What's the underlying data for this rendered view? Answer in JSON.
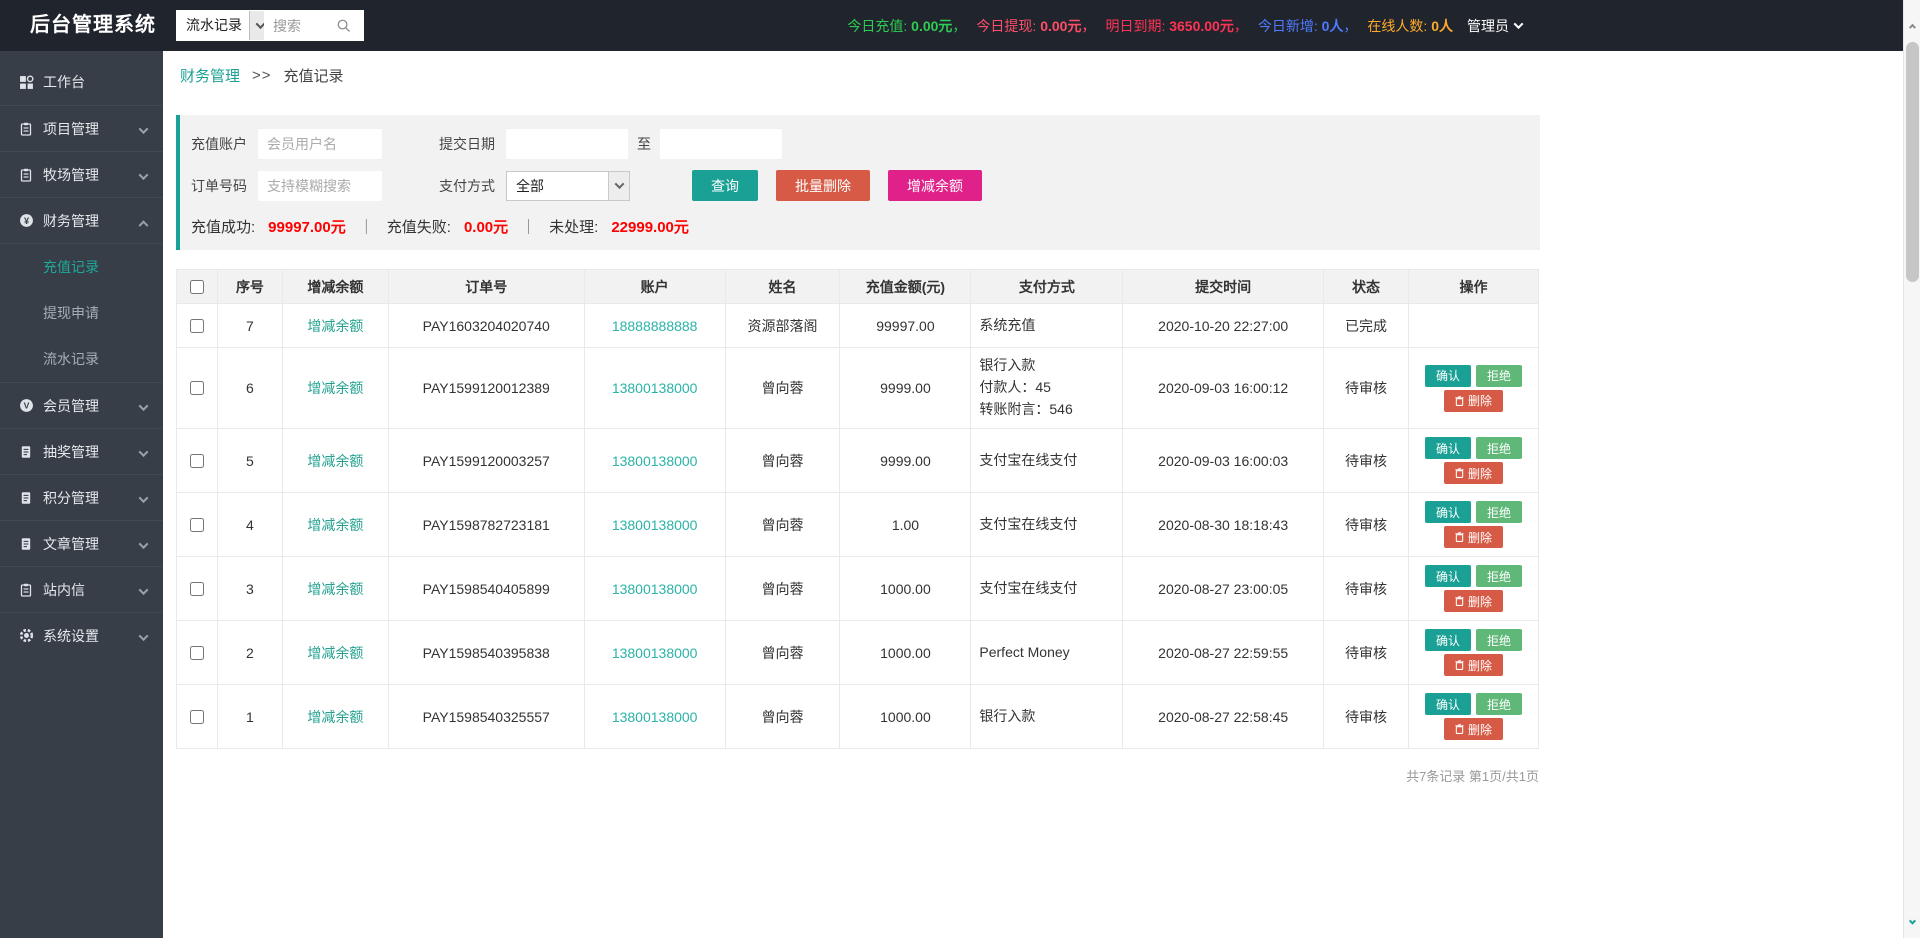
{
  "app_title": "后台管理系统",
  "colors": {
    "accent": "#1aa094",
    "success": "#5FB878",
    "danger": "#d65a45",
    "magenta": "#e0218a",
    "stat_value_red": "#ff0000"
  },
  "topbar": {
    "module_select_value": "流水记录",
    "search_placeholder": "搜索",
    "stats": [
      {
        "label": "今日充值:",
        "value": "0.00元",
        "sep": "，",
        "color": "#2ecc52"
      },
      {
        "label": "今日提现:",
        "value": "0.00元",
        "sep": "，",
        "color": "#ff4e6a"
      },
      {
        "label": "明日到期:",
        "value": "3650.00元",
        "sep": "，",
        "color": "#ff3355"
      },
      {
        "label": "今日新增:",
        "value": "0人",
        "sep": "，",
        "color": "#4f7bff"
      },
      {
        "label": "在线人数:",
        "value": "0人",
        "sep": "",
        "color": "#ffaa2b"
      }
    ],
    "admin_label": "管理员"
  },
  "sidebar": {
    "items": [
      {
        "label": "工作台",
        "icon": "grid-icon"
      },
      {
        "label": "项目管理",
        "icon": "clipboard-icon"
      },
      {
        "label": "牧场管理",
        "icon": "clipboard-icon"
      },
      {
        "label": "财务管理",
        "icon": "finance-icon",
        "expanded": true,
        "children": [
          "充值记录",
          "提现申请",
          "流水记录"
        ],
        "active_child": "充值记录"
      },
      {
        "label": "会员管理",
        "icon": "member-icon"
      },
      {
        "label": "抽奖管理",
        "icon": "doc-icon"
      },
      {
        "label": "积分管理",
        "icon": "doc-icon"
      },
      {
        "label": "文章管理",
        "icon": "doc-icon"
      },
      {
        "label": "站内信",
        "icon": "clipboard-icon"
      },
      {
        "label": "系统设置",
        "icon": "gear-icon"
      }
    ]
  },
  "breadcrumb": {
    "section": "财务管理",
    "separator": ">>",
    "current": "充值记录"
  },
  "filter": {
    "account_label": "充值账户",
    "account_placeholder": "会员用户名",
    "date_label": "提交日期",
    "date_to_label": "至",
    "order_label": "订单号码",
    "order_placeholder": "支持模糊搜索",
    "pay_label": "支付方式",
    "pay_select_value": "全部",
    "buttons": {
      "query": "查询",
      "batch_delete": "批量删除",
      "adjust_balance": "增减余额"
    },
    "summary_separator": "｜",
    "summary": [
      {
        "label": "充值成功:",
        "value": "99997.00元"
      },
      {
        "label": "充值失败:",
        "value": "0.00元"
      },
      {
        "label": "未处理:",
        "value": "22999.00元"
      }
    ]
  },
  "table": {
    "headers": [
      "序号",
      "增减余额",
      "订单号",
      "账户",
      "姓名",
      "充值金额(元)",
      "支付方式",
      "提交时间",
      "状态",
      "操作"
    ],
    "adjust_link_label": "增减余额",
    "actions": {
      "confirm": "确认",
      "reject": "拒绝",
      "delete": "删除"
    },
    "rows": [
      {
        "seq": "7",
        "order_no": "PAY1603204020740",
        "account": "18888888888",
        "name": "资源部落阁",
        "amount": "99997.00",
        "pay_method": "系统充值",
        "time": "2020-10-20 22:27:00",
        "status": "已完成",
        "has_actions": false
      },
      {
        "seq": "6",
        "order_no": "PAY1599120012389",
        "account": "13800138000",
        "name": "曾向蓉",
        "amount": "9999.00",
        "pay_method": "银行入款\n付款人：45\n转账附言：546",
        "time": "2020-09-03 16:00:12",
        "status": "待审核",
        "has_actions": true
      },
      {
        "seq": "5",
        "order_no": "PAY1599120003257",
        "account": "13800138000",
        "name": "曾向蓉",
        "amount": "9999.00",
        "pay_method": "支付宝在线支付",
        "time": "2020-09-03 16:00:03",
        "status": "待审核",
        "has_actions": true
      },
      {
        "seq": "4",
        "order_no": "PAY1598782723181",
        "account": "13800138000",
        "name": "曾向蓉",
        "amount": "1.00",
        "pay_method": "支付宝在线支付",
        "time": "2020-08-30 18:18:43",
        "status": "待审核",
        "has_actions": true
      },
      {
        "seq": "3",
        "order_no": "PAY1598540405899",
        "account": "13800138000",
        "name": "曾向蓉",
        "amount": "1000.00",
        "pay_method": "支付宝在线支付",
        "time": "2020-08-27 23:00:05",
        "status": "待审核",
        "has_actions": true
      },
      {
        "seq": "2",
        "order_no": "PAY1598540395838",
        "account": "13800138000",
        "name": "曾向蓉",
        "amount": "1000.00",
        "pay_method": "Perfect Money",
        "time": "2020-08-27 22:59:55",
        "status": "待审核",
        "has_actions": true
      },
      {
        "seq": "1",
        "order_no": "PAY1598540325557",
        "account": "13800138000",
        "name": "曾向蓉",
        "amount": "1000.00",
        "pay_method": "银行入款",
        "time": "2020-08-27 22:58:45",
        "status": "待审核",
        "has_actions": true
      }
    ]
  },
  "footer": {
    "record_summary": "共7条记录 第1页/共1页"
  }
}
